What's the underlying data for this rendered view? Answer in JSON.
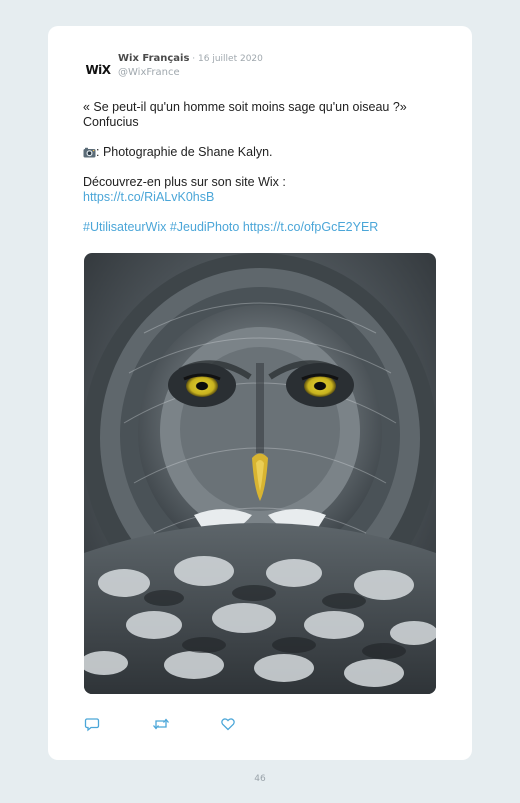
{
  "tweet": {
    "logo_text": "WiX",
    "author": "Wix Français",
    "separator": " · ",
    "date": "16 juillet 2020",
    "handle": "@WixFrance",
    "quote_line": "« Se peut-il qu'un homme soit moins sage qu'un oiseau ?»",
    "quote_author": "Confucius",
    "photo_credit": ": Photographie de Shane Kalyn.",
    "discover_text": "Découvrez-en plus sur son site Wix :",
    "site_link": "https://t.co/RiALvK0hsB",
    "hashtag_1": "#UtilisateurWix",
    "hashtag_2": "#JeudiPhoto",
    "tweet_link": "https://t.co/ofpGcE2YER",
    "image_icon": "owl-photo"
  },
  "actions": {
    "reply_icon": "reply-icon",
    "retweet_icon": "retweet-icon",
    "like_icon": "heart-icon"
  },
  "page": {
    "number": "46"
  },
  "colors": {
    "background": "#e6edf0",
    "card": "#ffffff",
    "link": "#4ba6d8",
    "muted": "#a0a8ae"
  }
}
